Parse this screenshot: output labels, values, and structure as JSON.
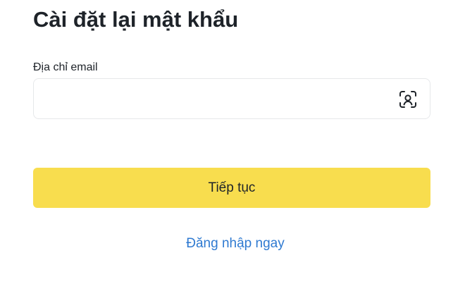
{
  "form": {
    "title": "Cài đặt lại mật khẩu",
    "email_label": "Địa chỉ email",
    "email_value": "",
    "email_placeholder": "",
    "scan_icon": "face-scan-icon",
    "continue_label": "Tiếp tục",
    "login_link_label": "Đăng nhập ngay"
  },
  "colors": {
    "primary_button": "#f8dd4e",
    "link": "#2f7ad1",
    "text": "#1e2329",
    "input_border": "#e6e8ea"
  }
}
